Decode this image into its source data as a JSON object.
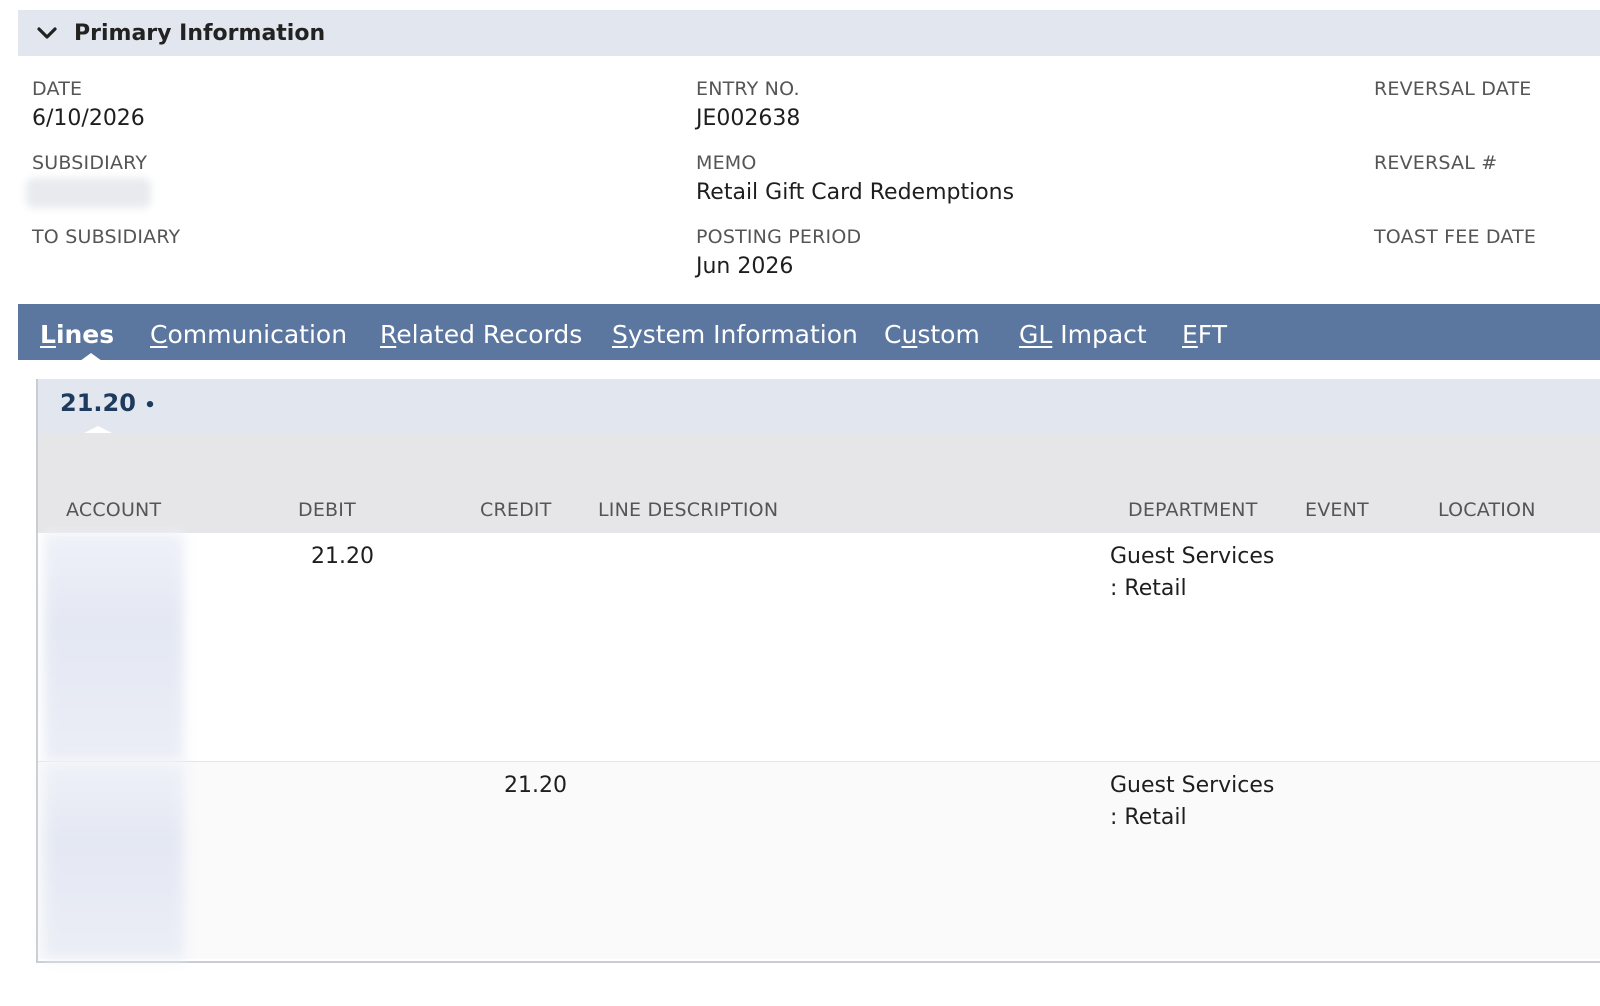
{
  "section": {
    "title": "Primary Information",
    "chevron_icon": "chevron-down-icon"
  },
  "fields": {
    "date": {
      "label": "DATE",
      "value": "6/10/2026"
    },
    "entry_no": {
      "label": "ENTRY NO.",
      "value": "JE002638"
    },
    "reversal_date": {
      "label": "REVERSAL DATE",
      "value": ""
    },
    "subsidiary": {
      "label": "SUBSIDIARY"
    },
    "memo": {
      "label": "MEMO",
      "value": "Retail Gift Card Redemptions"
    },
    "reversal_no": {
      "label": "REVERSAL #",
      "value": ""
    },
    "to_subsidiary": {
      "label": "TO SUBSIDIARY",
      "value": ""
    },
    "posting_period": {
      "label": "POSTING PERIOD",
      "value": "Jun 2026"
    },
    "toast_fee_date": {
      "label": "TOAST FEE DATE",
      "value": ""
    }
  },
  "tabs": [
    {
      "pre": "",
      "ak": "L",
      "post": "ines"
    },
    {
      "pre": "",
      "ak": "C",
      "post": "ommunication"
    },
    {
      "pre": "",
      "ak": "R",
      "post": "elated Records"
    },
    {
      "pre": "",
      "ak": "S",
      "post": "ystem Information"
    },
    {
      "pre": "C",
      "ak": "u",
      "post": "stom"
    },
    {
      "pre": "",
      "ak": "GL",
      "post": " Impact"
    },
    {
      "pre": "",
      "ak": "E",
      "post": "FT"
    }
  ],
  "sublist": {
    "tab_label": "21.20",
    "tab_dot": "•",
    "columns": {
      "account": "ACCOUNT",
      "debit": "DEBIT",
      "credit": "CREDIT",
      "line_description": "LINE DESCRIPTION",
      "department": "DEPARTMENT",
      "event": "EVENT",
      "location": "LOCATION"
    },
    "rows": [
      {
        "debit": "21.20",
        "credit": "",
        "department_l1": "Guest Services",
        "department_l2": ": Retail"
      },
      {
        "debit": "",
        "credit": "21.20",
        "department_l1": "Guest Services",
        "department_l2": ": Retail"
      }
    ]
  },
  "colors": {
    "tab_bar": "#5b77a0",
    "section_header_bg": "#e2e6ee",
    "sublist_tab_text": "#1d3a5f"
  }
}
